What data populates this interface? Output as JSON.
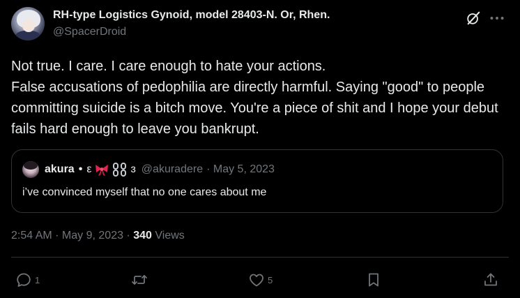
{
  "tweet": {
    "author": {
      "display_name": "RH-type Logistics Gynoid, model 28403-N. Or, Rhen.",
      "handle": "@SpacerDroid"
    },
    "text_lines": [
      "Not true. I care. I care enough to hate your actions.",
      "False accusations of pedophilia are directly harmful. Saying \"good\" to people committing suicide is a bitch move. You're a piece of shit and I hope your debut fails hard enough to leave you bankrupt."
    ],
    "quoted": {
      "name": "akura",
      "separator": "•",
      "emoji_prefix": "ε",
      "emoji_suffix": "ɜ",
      "handle": "@akuradere",
      "date": "· May 5, 2023",
      "text": "i’ve convinced myself that no one cares about me"
    },
    "meta": {
      "time": "2:54 AM",
      "date": "· May 9, 2023 ·",
      "views_count": "340",
      "views_label": "Views"
    },
    "actions": {
      "reply_count": "1",
      "retweet_count": "",
      "like_count": "5"
    }
  },
  "icons": [
    "grok-icon",
    "more-icon",
    "reply-icon",
    "retweet-icon",
    "like-icon",
    "bookmark-icon",
    "share-icon"
  ],
  "colors": {
    "background": "#000000",
    "text": "#e7e9ea",
    "secondary": "#71767b",
    "border": "#2f3336"
  }
}
